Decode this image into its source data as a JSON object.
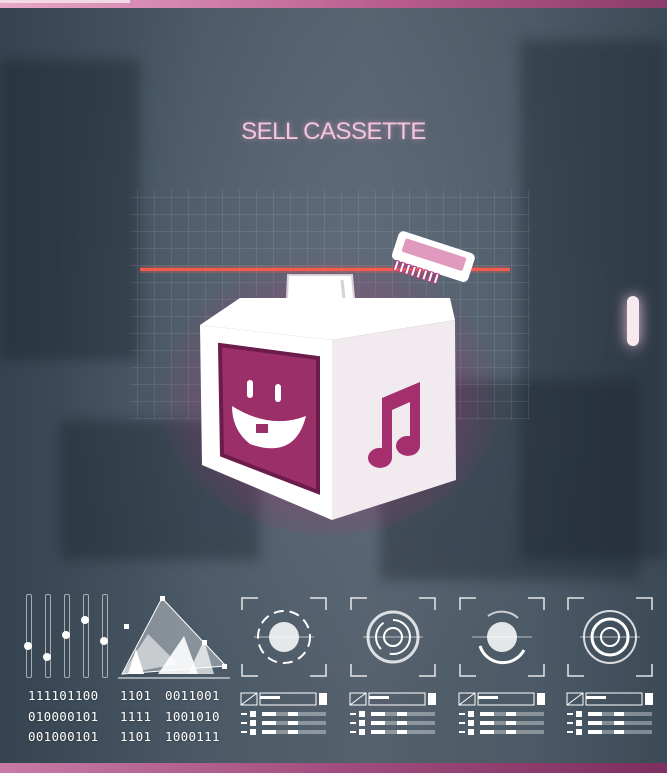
{
  "screen": {
    "title": "SELL CASSETTE"
  },
  "colors": {
    "accent_pink": "#f3c6dc",
    "glow_magenta": "#c2357c",
    "scan_line": "#ff5a4a"
  },
  "icon": {
    "name": "cassette-sell-box-icon"
  },
  "hud": {
    "slider_levels": [
      0.35,
      0.2,
      0.5,
      0.7,
      0.42
    ],
    "binary_col1": [
      "111101100",
      "010000101",
      "001000101"
    ],
    "binary_col2": [
      "1101",
      "1111",
      "1101"
    ],
    "binary_col3": [
      "0011001",
      "1001010",
      "1000111"
    ],
    "scopes": [
      "target-scope-1",
      "target-scope-2",
      "target-scope-3",
      "target-scope-4"
    ]
  }
}
